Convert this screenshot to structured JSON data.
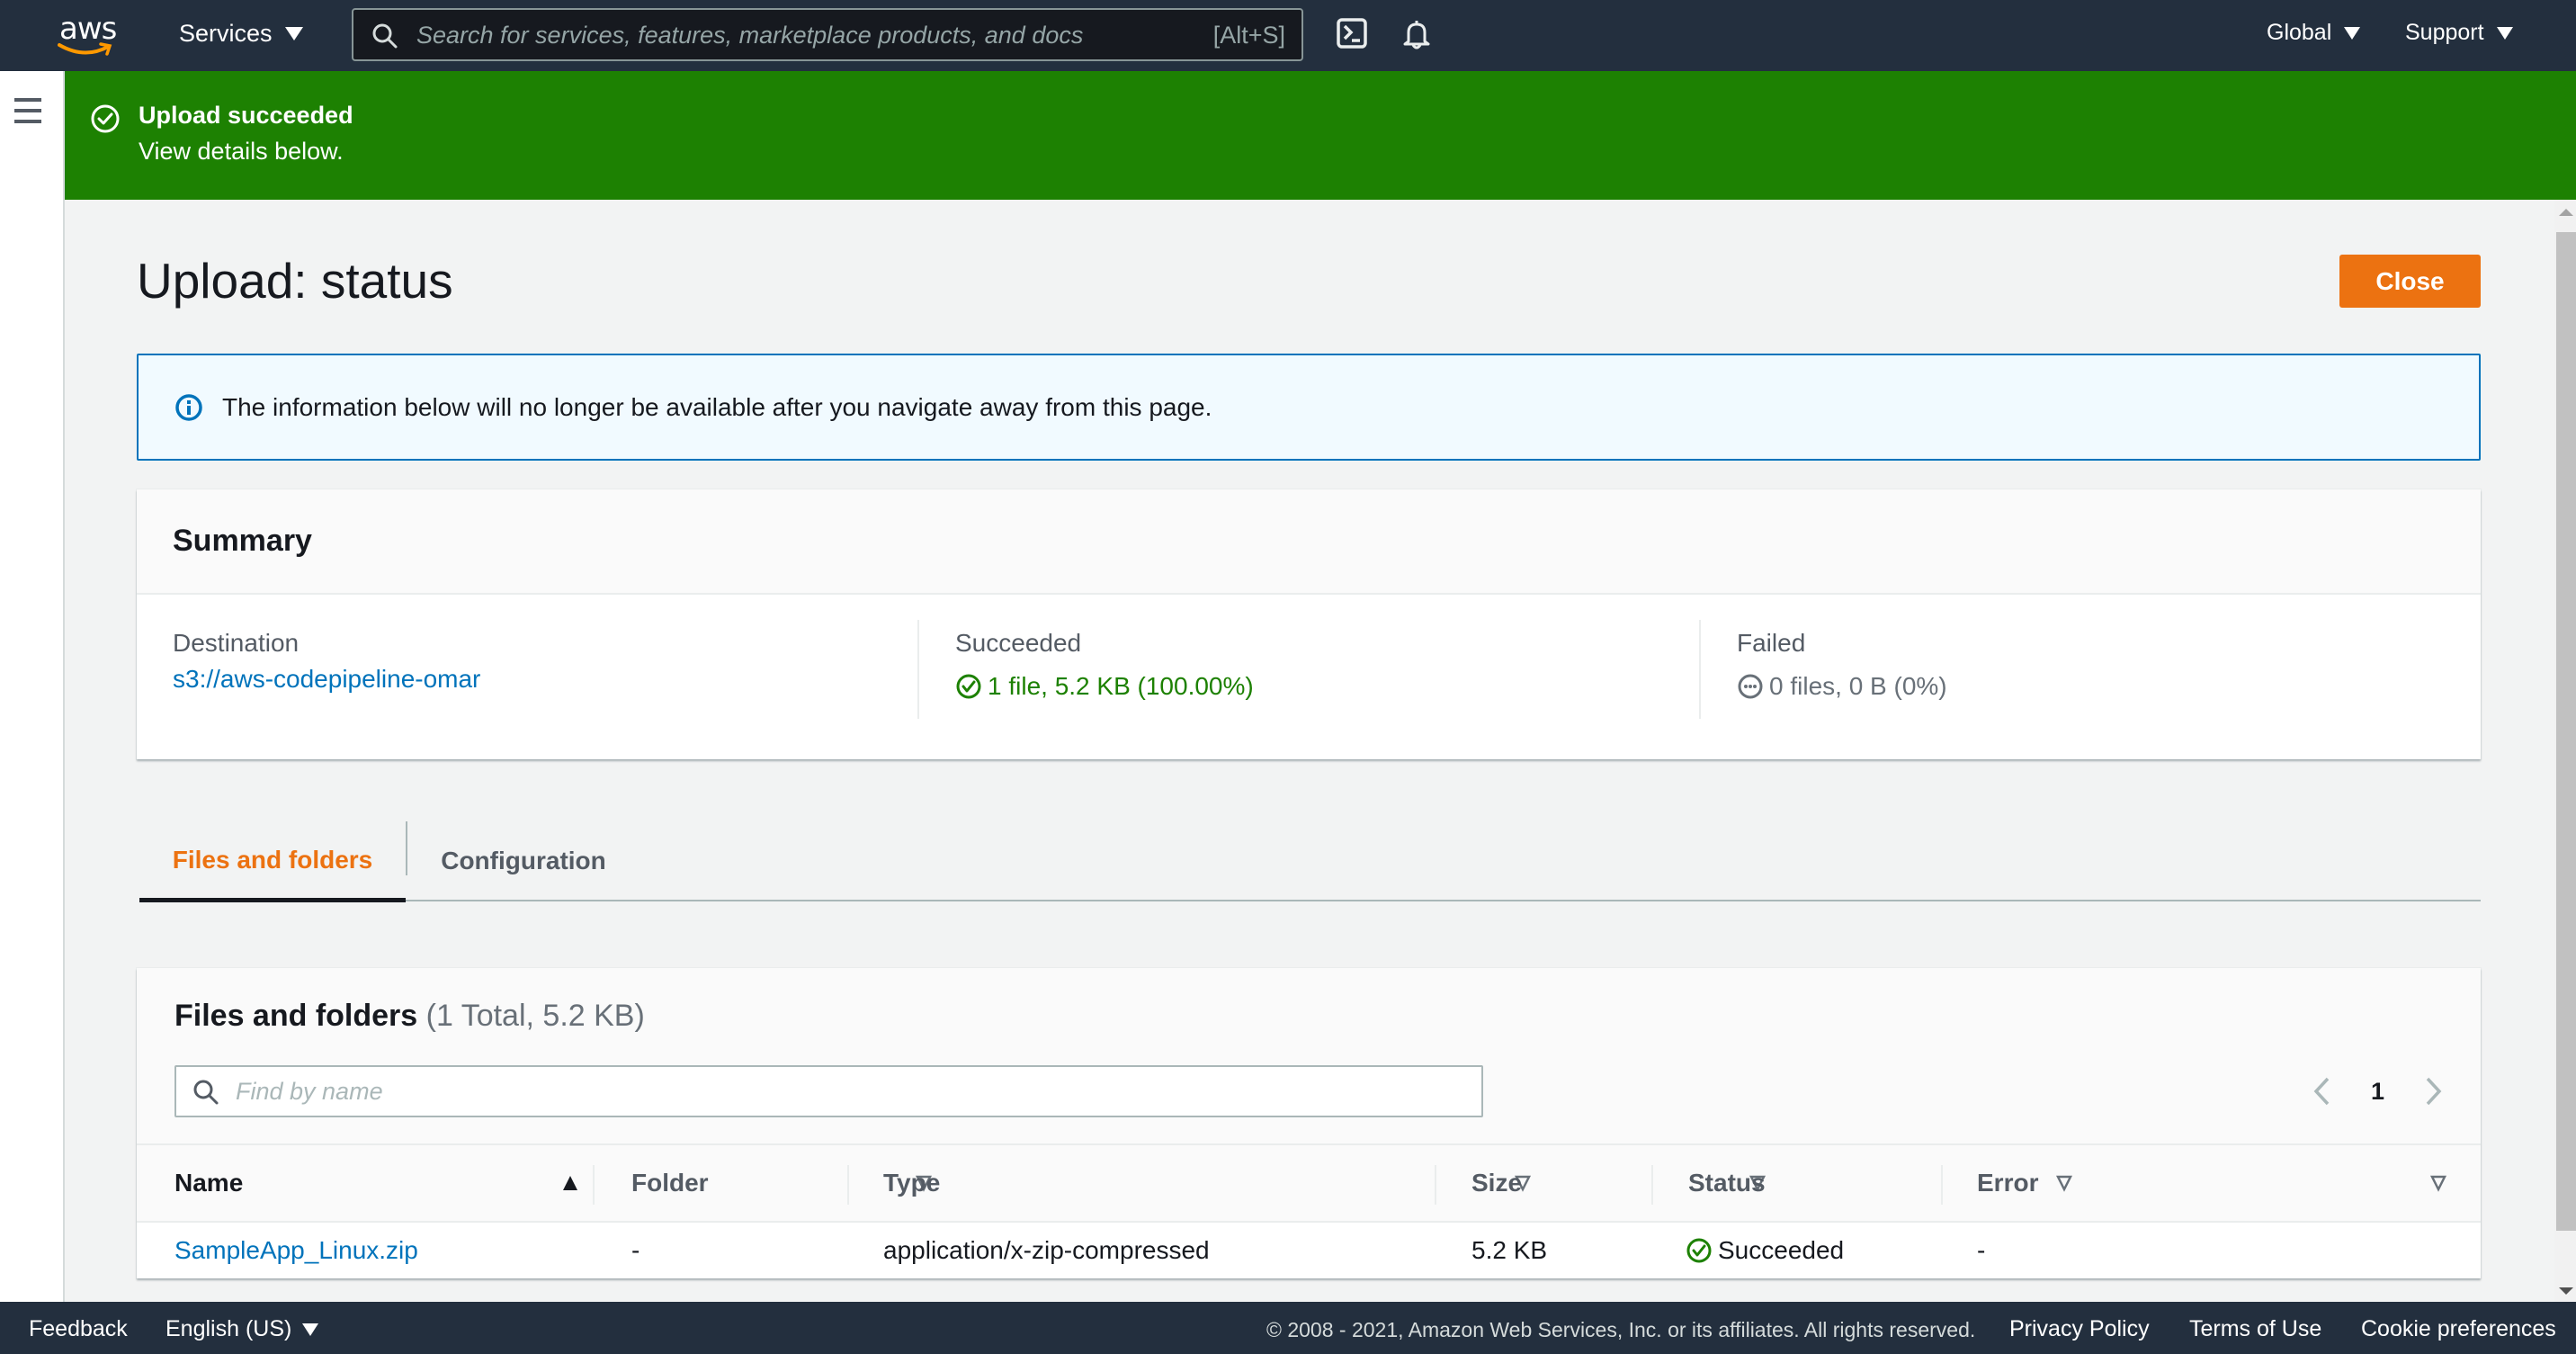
{
  "topnav": {
    "logo_text": "aws",
    "services_label": "Services",
    "search_placeholder": "Search for services, features, marketplace products, and docs",
    "search_shortcut": "[Alt+S]",
    "region_label": "Global",
    "support_label": "Support",
    "icons": [
      "cloudshell-icon",
      "notifications-bell-icon"
    ]
  },
  "flash": {
    "type": "success",
    "title": "Upload succeeded",
    "body": "View details below.",
    "color": "#1d8102"
  },
  "page": {
    "title": "Upload: status",
    "close_label": "Close",
    "accent_color": "#ec7211"
  },
  "info_alert": {
    "text": "The information below will no longer be available after you navigate away from this page."
  },
  "summary": {
    "heading": "Summary",
    "destination": {
      "label": "Destination",
      "value": "s3://aws-codepipeline-omar"
    },
    "succeeded": {
      "label": "Succeeded",
      "value": "1 file, 5.2 KB (100.00%)"
    },
    "failed": {
      "label": "Failed",
      "value": "0 files, 0 B (0%)"
    }
  },
  "tabs": [
    {
      "label": "Files and folders",
      "active": true
    },
    {
      "label": "Configuration",
      "active": false
    }
  ],
  "files_table": {
    "heading": "Files and folders",
    "count": "(1 Total, 5.2 KB)",
    "search_placeholder": "Find by name",
    "current_page": "1",
    "columns": [
      {
        "label": "Name",
        "sort": "ascending"
      },
      {
        "label": "Folder",
        "sort": "none"
      },
      {
        "label": "Type",
        "sort": "none"
      },
      {
        "label": "Size",
        "sort": "none"
      },
      {
        "label": "Status",
        "sort": "none"
      },
      {
        "label": "Error",
        "sort": "none"
      }
    ],
    "rows": [
      {
        "name": "SampleApp_Linux.zip",
        "folder": "-",
        "type": "application/x-zip-compressed",
        "size": "5.2 KB",
        "status": "Succeeded",
        "error": "-"
      }
    ]
  },
  "footer": {
    "feedback": "Feedback",
    "language": "English (US)",
    "copyright": "© 2008 - 2021, Amazon Web Services, Inc. or its affiliates. All rights reserved.",
    "privacy": "Privacy Policy",
    "terms": "Terms of Use",
    "cookies": "Cookie preferences"
  }
}
